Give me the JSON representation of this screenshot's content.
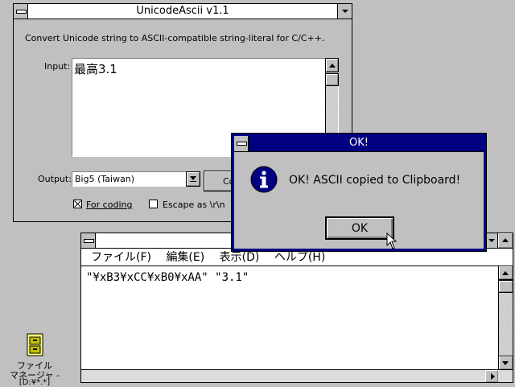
{
  "main_window": {
    "title": "UnicodeAscii v1.1",
    "description": "Convert Unicode string to ASCII-compatible string-literal for C/C++.",
    "input_label": "Input:",
    "input_value": "最高3.1",
    "output_label": "Output:",
    "output_selected": "Big5 (Taiwan)",
    "copy_button_label": "Co",
    "for_coding_label": "For coding",
    "for_coding_checked": true,
    "escape_label": "Escape as \\r\\n",
    "escape_checked": false
  },
  "dialog": {
    "title": "OK!",
    "message": "OK! ASCII copied to Clipboard!",
    "ok_label": "OK",
    "icon": "info-icon"
  },
  "editor": {
    "menu": [
      "ファイル(F)",
      "編集(E)",
      "表示(D)",
      "ヘルプ(H)"
    ],
    "content": "\"¥xB3¥xCC¥xB0¥xAA\" \"3.1\""
  },
  "desktop_icon": {
    "label_line1": "ファイル",
    "label_line2": "マネージャ -",
    "label_line3": "[D:¥*.*]"
  },
  "colors": {
    "desktop": "#c0c0c0",
    "active_title": "#000080",
    "dialog_border": "#000080",
    "info_icon": "#000080"
  }
}
